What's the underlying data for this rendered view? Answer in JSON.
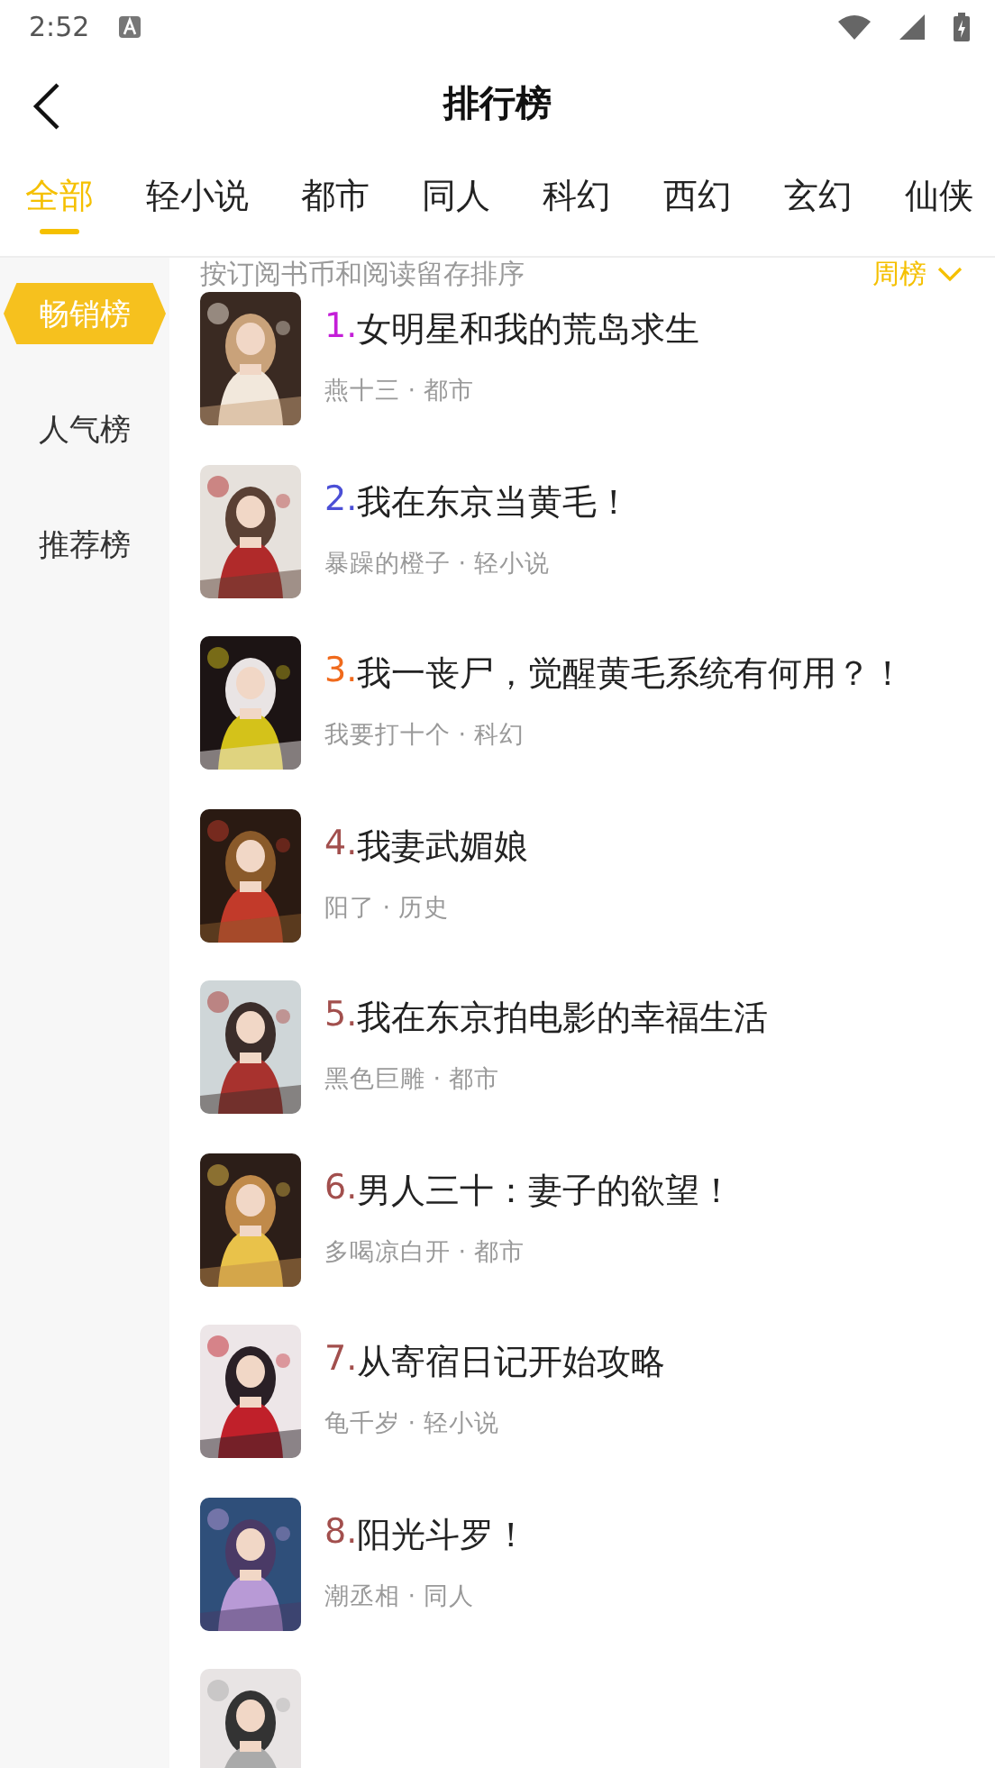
{
  "status_bar": {
    "time": "2:52"
  },
  "header": {
    "title": "排行榜"
  },
  "tabs": [
    {
      "label": "全部",
      "selected": true
    },
    {
      "label": "轻小说",
      "selected": false
    },
    {
      "label": "都市",
      "selected": false
    },
    {
      "label": "同人",
      "selected": false
    },
    {
      "label": "科幻",
      "selected": false
    },
    {
      "label": "西幻",
      "selected": false
    },
    {
      "label": "玄幻",
      "selected": false
    },
    {
      "label": "仙侠",
      "selected": false
    }
  ],
  "sidebar": {
    "items": [
      {
        "label": "畅销榜",
        "selected": true
      },
      {
        "label": "人气榜",
        "selected": false
      },
      {
        "label": "推荐榜",
        "selected": false
      }
    ]
  },
  "ranking": {
    "description": "按订阅书币和阅读留存排序",
    "period": "周榜",
    "books": [
      {
        "kind": "book",
        "rank": "1.",
        "title": "女明星和我的荒岛求生",
        "meta": "燕十三 · 都市",
        "color": "#c41fd8"
      },
      {
        "kind": "book",
        "rank": "2.",
        "title": "我在东京当黄毛！",
        "meta": "暴躁的橙子 · 轻小说",
        "color": "#4b4fd6"
      },
      {
        "kind": "book",
        "rank": "3.",
        "title": "我一丧尸，觉醒黄毛系统有何用？！",
        "meta": "我要打十个 · 科幻",
        "color": "#f06a1c"
      },
      {
        "kind": "book",
        "rank": "4.",
        "title": "我妻武媚娘",
        "meta": "阳了 · 历史",
        "color": "#a24f4d"
      },
      {
        "kind": "book",
        "rank": "5.",
        "title": "我在东京拍电影的幸福生活",
        "meta": "黑色巨雕 · 都市",
        "color": "#a24f4d"
      },
      {
        "kind": "book",
        "rank": "6.",
        "title": "男人三十：妻子的欲望！",
        "meta": "多喝凉白开 · 都市",
        "color": "#a24f4d"
      },
      {
        "kind": "book",
        "rank": "7.",
        "title": "从寄宿日记开始攻略",
        "meta": "龟千岁 · 轻小说",
        "color": "#a24f4d"
      },
      {
        "kind": "book",
        "rank": "8.",
        "title": "阳光斗罗！",
        "meta": "潮丞相 · 同人",
        "color": "#a24f4d"
      },
      {
        "kind": "cover-only"
      }
    ]
  }
}
